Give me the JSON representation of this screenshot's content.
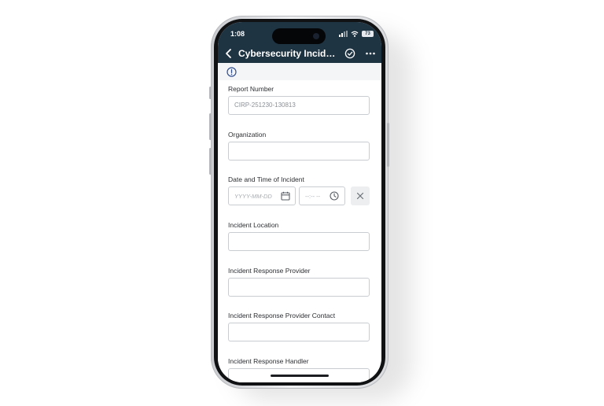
{
  "status_bar": {
    "time": "1:08",
    "battery": "73"
  },
  "header": {
    "title": "Cybersecurity Inciden...",
    "icons": [
      "back-chevron-icon",
      "check-circle-icon",
      "more-horizontal-icon"
    ]
  },
  "info_icon": "info-circle-icon",
  "form": {
    "report_number": {
      "label": "Report Number",
      "value": "CIRP-251230-130813"
    },
    "organization": {
      "label": "Organization",
      "value": ""
    },
    "incident_datetime": {
      "label": "Date and Time of Incident",
      "date_placeholder": "YYYY-MM-DD",
      "time_placeholder": "--:-- --"
    },
    "incident_location": {
      "label": "Incident Location",
      "value": ""
    },
    "response_provider": {
      "label": "Incident Response Provider",
      "value": ""
    },
    "response_provider_contact": {
      "label": "Incident Response Provider Contact",
      "value": ""
    },
    "response_handler": {
      "label": "Incident Response Handler",
      "value": ""
    }
  },
  "colors": {
    "header_bg": "#1f3443",
    "accent": "#2f4d8f",
    "input_border": "#c9ccd1"
  }
}
